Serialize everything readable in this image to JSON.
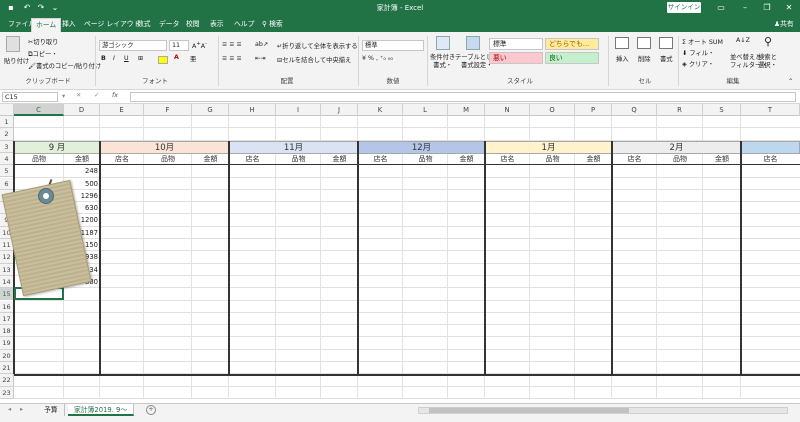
{
  "window": {
    "title": "家計簿 - Excel",
    "signin_label": "サインイン",
    "share_label": "共有",
    "tell_me": "検索"
  },
  "tabs": [
    "ファイル",
    "ホーム",
    "挿入",
    "ページ レイアウト",
    "数式",
    "データ",
    "校閲",
    "表示",
    "ヘルプ"
  ],
  "active_tab": "ホーム",
  "ribbon": {
    "clipboard": {
      "paste": "貼り付け",
      "cut": "切り取り",
      "copy": "コピー・",
      "format_painter": "書式のコピー/貼り付け",
      "label": "クリップボード"
    },
    "font": {
      "name": "游ゴシック",
      "size": "11",
      "bold": "B",
      "italic": "I",
      "underline": "U",
      "label": "フォント"
    },
    "alignment": {
      "wrap": "折り返して全体を表示する",
      "merge": "セルを結合して中央揃え",
      "label": "配置"
    },
    "number": {
      "format": "標準",
      "label": "数値"
    },
    "styles": {
      "conditional": "条件付き\n書式",
      "table": "テーブルとして\n書式設定",
      "cells": [
        {
          "text": "標準",
          "bg": "#ffffff",
          "color": "#222222"
        },
        {
          "text": "どちらでも...",
          "bg": "#ffeb9c",
          "color": "#9c6500"
        },
        {
          "text": "悪い",
          "bg": "#ffc7ce",
          "color": "#9c0006"
        },
        {
          "text": "良い",
          "bg": "#c6efce",
          "color": "#006100"
        }
      ],
      "label": "スタイル"
    },
    "cells": {
      "insert": "挿入",
      "delete": "削除",
      "format": "書式",
      "label": "セル"
    },
    "editing": {
      "autosum": "オート SUM",
      "fill": "フィル・",
      "clear": "クリア・",
      "sort": "並べ替えと\nフィルター",
      "find": "検索と\n選択",
      "label": "編集"
    }
  },
  "name_box": "C15",
  "columns": [
    "C",
    "D",
    "E",
    "F",
    "G",
    "H",
    "I",
    "J",
    "K",
    "L",
    "M",
    "N",
    "O",
    "P",
    "Q",
    "R",
    "S",
    "T"
  ],
  "selected_column": "C",
  "rows": [
    "1",
    "2",
    "3",
    "4",
    "5",
    "6",
    "7",
    "8",
    "9",
    "10",
    "11",
    "12",
    "13",
    "14",
    "15",
    "16",
    "17",
    "18",
    "19",
    "20",
    "21",
    "22",
    "23"
  ],
  "selected_row": "15",
  "months": [
    {
      "label": "9 月",
      "color": "#e2efd9"
    },
    {
      "label": "10月",
      "color": "#fbe4d5"
    },
    {
      "label": "11月",
      "color": "#dae3f3"
    },
    {
      "label": "12月",
      "color": "#b4c6e7"
    },
    {
      "label": "1月",
      "color": "#fff2cc"
    },
    {
      "label": "2月",
      "color": "#ededed"
    },
    {
      "label": "",
      "color": "#bdd7ee"
    }
  ],
  "headers": {
    "sep": [
      "品物",
      "金額"
    ],
    "repeat": [
      "店名",
      "品物",
      "金額"
    ],
    "last": "店名"
  },
  "amounts": [
    "248",
    "500",
    "1296",
    "630",
    "1200",
    "1187",
    "1150",
    "1938",
    "1334",
    "880"
  ],
  "sheets": [
    "予算",
    "家計簿2019. 9～"
  ],
  "active_sheet": "家計簿2019. 9～",
  "sheet_add": "+"
}
